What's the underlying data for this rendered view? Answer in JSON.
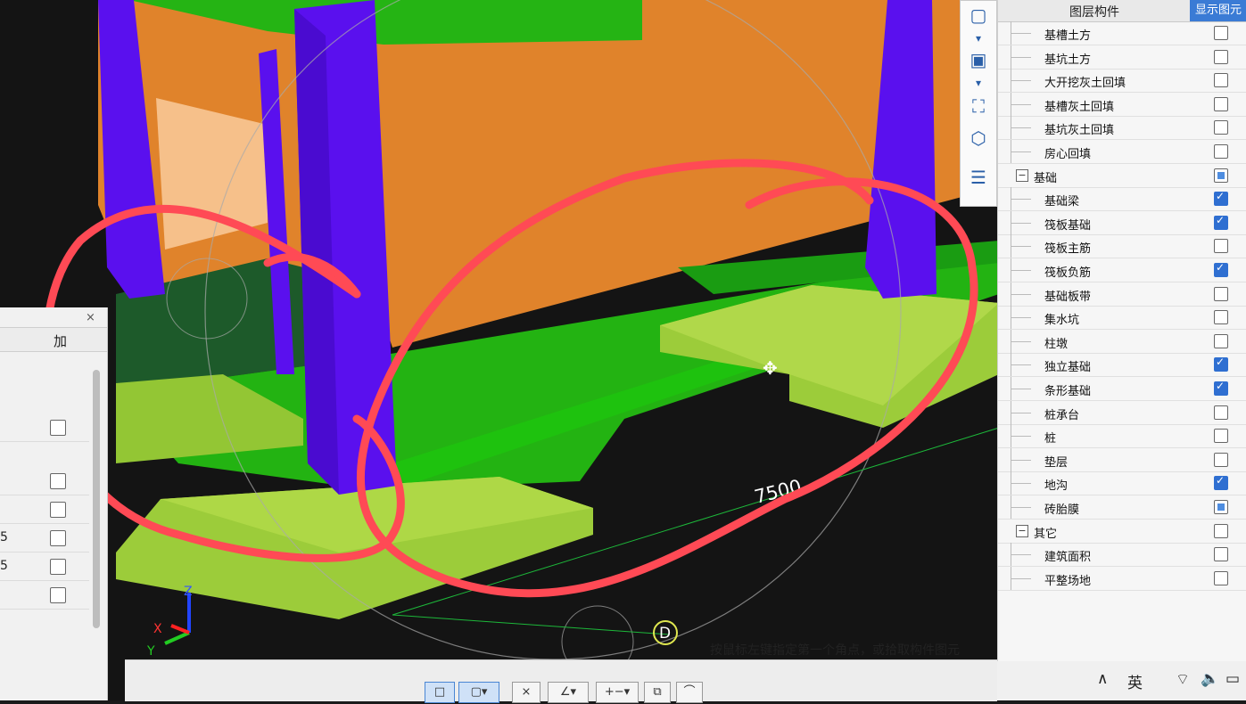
{
  "left_panel": {
    "close_glyph": "×",
    "column_header": "加",
    "rows": [
      {
        "num": "",
        "checked": false
      },
      {
        "num": "",
        "checked": false
      },
      {
        "num": "",
        "checked": false
      },
      {
        "num": "5",
        "checked": false
      },
      {
        "num": "5",
        "checked": false
      },
      {
        "num": "",
        "checked": false
      }
    ]
  },
  "layer_panel": {
    "header_name": "图层构件",
    "header_show": "显示图元",
    "rows": [
      {
        "label": "基槽土方",
        "level": 2,
        "state": "off"
      },
      {
        "label": "基坑土方",
        "level": 2,
        "state": "off"
      },
      {
        "label": "大开挖灰土回填",
        "level": 2,
        "state": "off"
      },
      {
        "label": "基槽灰土回填",
        "level": 2,
        "state": "off"
      },
      {
        "label": "基坑灰土回填",
        "level": 2,
        "state": "off"
      },
      {
        "label": "房心回填",
        "level": 2,
        "state": "off"
      },
      {
        "label": "基础",
        "level": 1,
        "state": "part",
        "group": "−"
      },
      {
        "label": "基础梁",
        "level": 2,
        "state": "on"
      },
      {
        "label": "筏板基础",
        "level": 2,
        "state": "on"
      },
      {
        "label": "筏板主筋",
        "level": 2,
        "state": "off"
      },
      {
        "label": "筏板负筋",
        "level": 2,
        "state": "on"
      },
      {
        "label": "基础板带",
        "level": 2,
        "state": "off"
      },
      {
        "label": "集水坑",
        "level": 2,
        "state": "off"
      },
      {
        "label": "柱墩",
        "level": 2,
        "state": "off"
      },
      {
        "label": "独立基础",
        "level": 2,
        "state": "on"
      },
      {
        "label": "条形基础",
        "level": 2,
        "state": "on"
      },
      {
        "label": "桩承台",
        "level": 2,
        "state": "off"
      },
      {
        "label": "桩",
        "level": 2,
        "state": "off"
      },
      {
        "label": "垫层",
        "level": 2,
        "state": "off"
      },
      {
        "label": "地沟",
        "level": 2,
        "state": "on"
      },
      {
        "label": "砖胎膜",
        "level": 2,
        "state": "part"
      },
      {
        "label": "其它",
        "level": 1,
        "state": "off",
        "group": "−"
      },
      {
        "label": "建筑面积",
        "level": 2,
        "state": "off"
      },
      {
        "label": "平整场地",
        "level": 2,
        "state": "off"
      }
    ]
  },
  "view_toolbar": [
    {
      "name": "view-cube-icon",
      "glyph": "▢"
    },
    {
      "name": "dropdown-arrow-icon",
      "glyph": "▾"
    },
    {
      "name": "solid-view-icon",
      "glyph": "▣"
    },
    {
      "name": "dropdown-arrow-icon",
      "glyph": "▾"
    },
    {
      "name": "zoom-extent-icon",
      "glyph": "⛶"
    },
    {
      "name": "dynamic-observe-icon",
      "glyph": "⬡"
    },
    {
      "name": "properties-icon",
      "glyph": "☰"
    }
  ],
  "viewport": {
    "dimension_text": "7500",
    "axis_label": "D",
    "axis_x": "X",
    "axis_y": "Y",
    "axis_z": "Z"
  },
  "status_bar": {
    "message": "按鼠标左键指定第一个角点，或拾取构件图元",
    "buttons": [
      {
        "name": "select-point-button",
        "glyph": "□",
        "active": true
      },
      {
        "name": "select-box-button",
        "glyph": "▢▾",
        "active": true
      },
      {
        "name": "cross-select-button",
        "glyph": "⨯",
        "active": false
      },
      {
        "name": "angle-button",
        "glyph": "∠▾",
        "active": false
      },
      {
        "name": "offset-button",
        "glyph": "+−▾",
        "active": false
      },
      {
        "name": "copy-button",
        "glyph": "⧉",
        "active": false
      },
      {
        "name": "arc-button",
        "glyph": "⌒",
        "active": false
      }
    ]
  },
  "taskbar": {
    "chevron": "∧",
    "ime": "英",
    "wifi": "⌔",
    "volume": "🔈",
    "battery": "▭"
  },
  "colors": {
    "orange_wall": "#e0832b",
    "green_beam": "#1ec20e",
    "purple_column": "#5a10ee",
    "olive_footing": "#9ccc3a",
    "red_annotation": "#ff4a55"
  }
}
